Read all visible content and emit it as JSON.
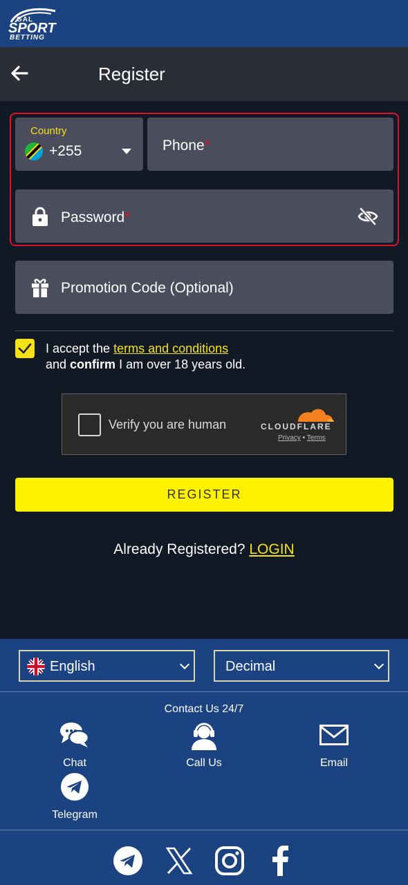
{
  "brand": {
    "logo_line1": "GAL",
    "logo_line2": "SPORT",
    "logo_line3": "BETTING"
  },
  "header": {
    "title": "Register"
  },
  "form": {
    "country_label": "Country",
    "country_flag": "tanzania-flag",
    "dial_code": "+255",
    "phone_label": "Phone",
    "password_label": "Password",
    "required_mark": "*",
    "promo_label": "Promotion Code (Optional)",
    "highlight_color": "#e0112b"
  },
  "terms": {
    "checked": true,
    "prefix": "I accept the ",
    "link": "terms and conditions",
    "line2_prefix": "and ",
    "line2_bold": "confirm",
    "line2_suffix": " I am over 18 years old."
  },
  "captcha": {
    "text": "Verify you are human",
    "brand": "CLOUDFLARE",
    "privacy": "Privacy",
    "separator": "•",
    "terms": "Terms"
  },
  "register_button": "REGISTER",
  "login_prompt": {
    "text": "Already Registered? ",
    "link": "LOGIN"
  },
  "footer": {
    "language": "English",
    "odds_format": "Decimal",
    "contact_title": "Contact Us 24/7",
    "contacts": [
      {
        "label": "Chat",
        "icon": "chat-icon"
      },
      {
        "label": "Call Us",
        "icon": "headset-icon"
      },
      {
        "label": "Email",
        "icon": "envelope-icon"
      },
      {
        "label": "Telegram",
        "icon": "telegram-icon"
      }
    ],
    "social": [
      "telegram-icon",
      "x-icon",
      "instagram-icon",
      "facebook-icon"
    ]
  },
  "colors": {
    "accent_yellow": "#fff200",
    "footer_blue": "#1b4382",
    "background": "#111a24"
  }
}
